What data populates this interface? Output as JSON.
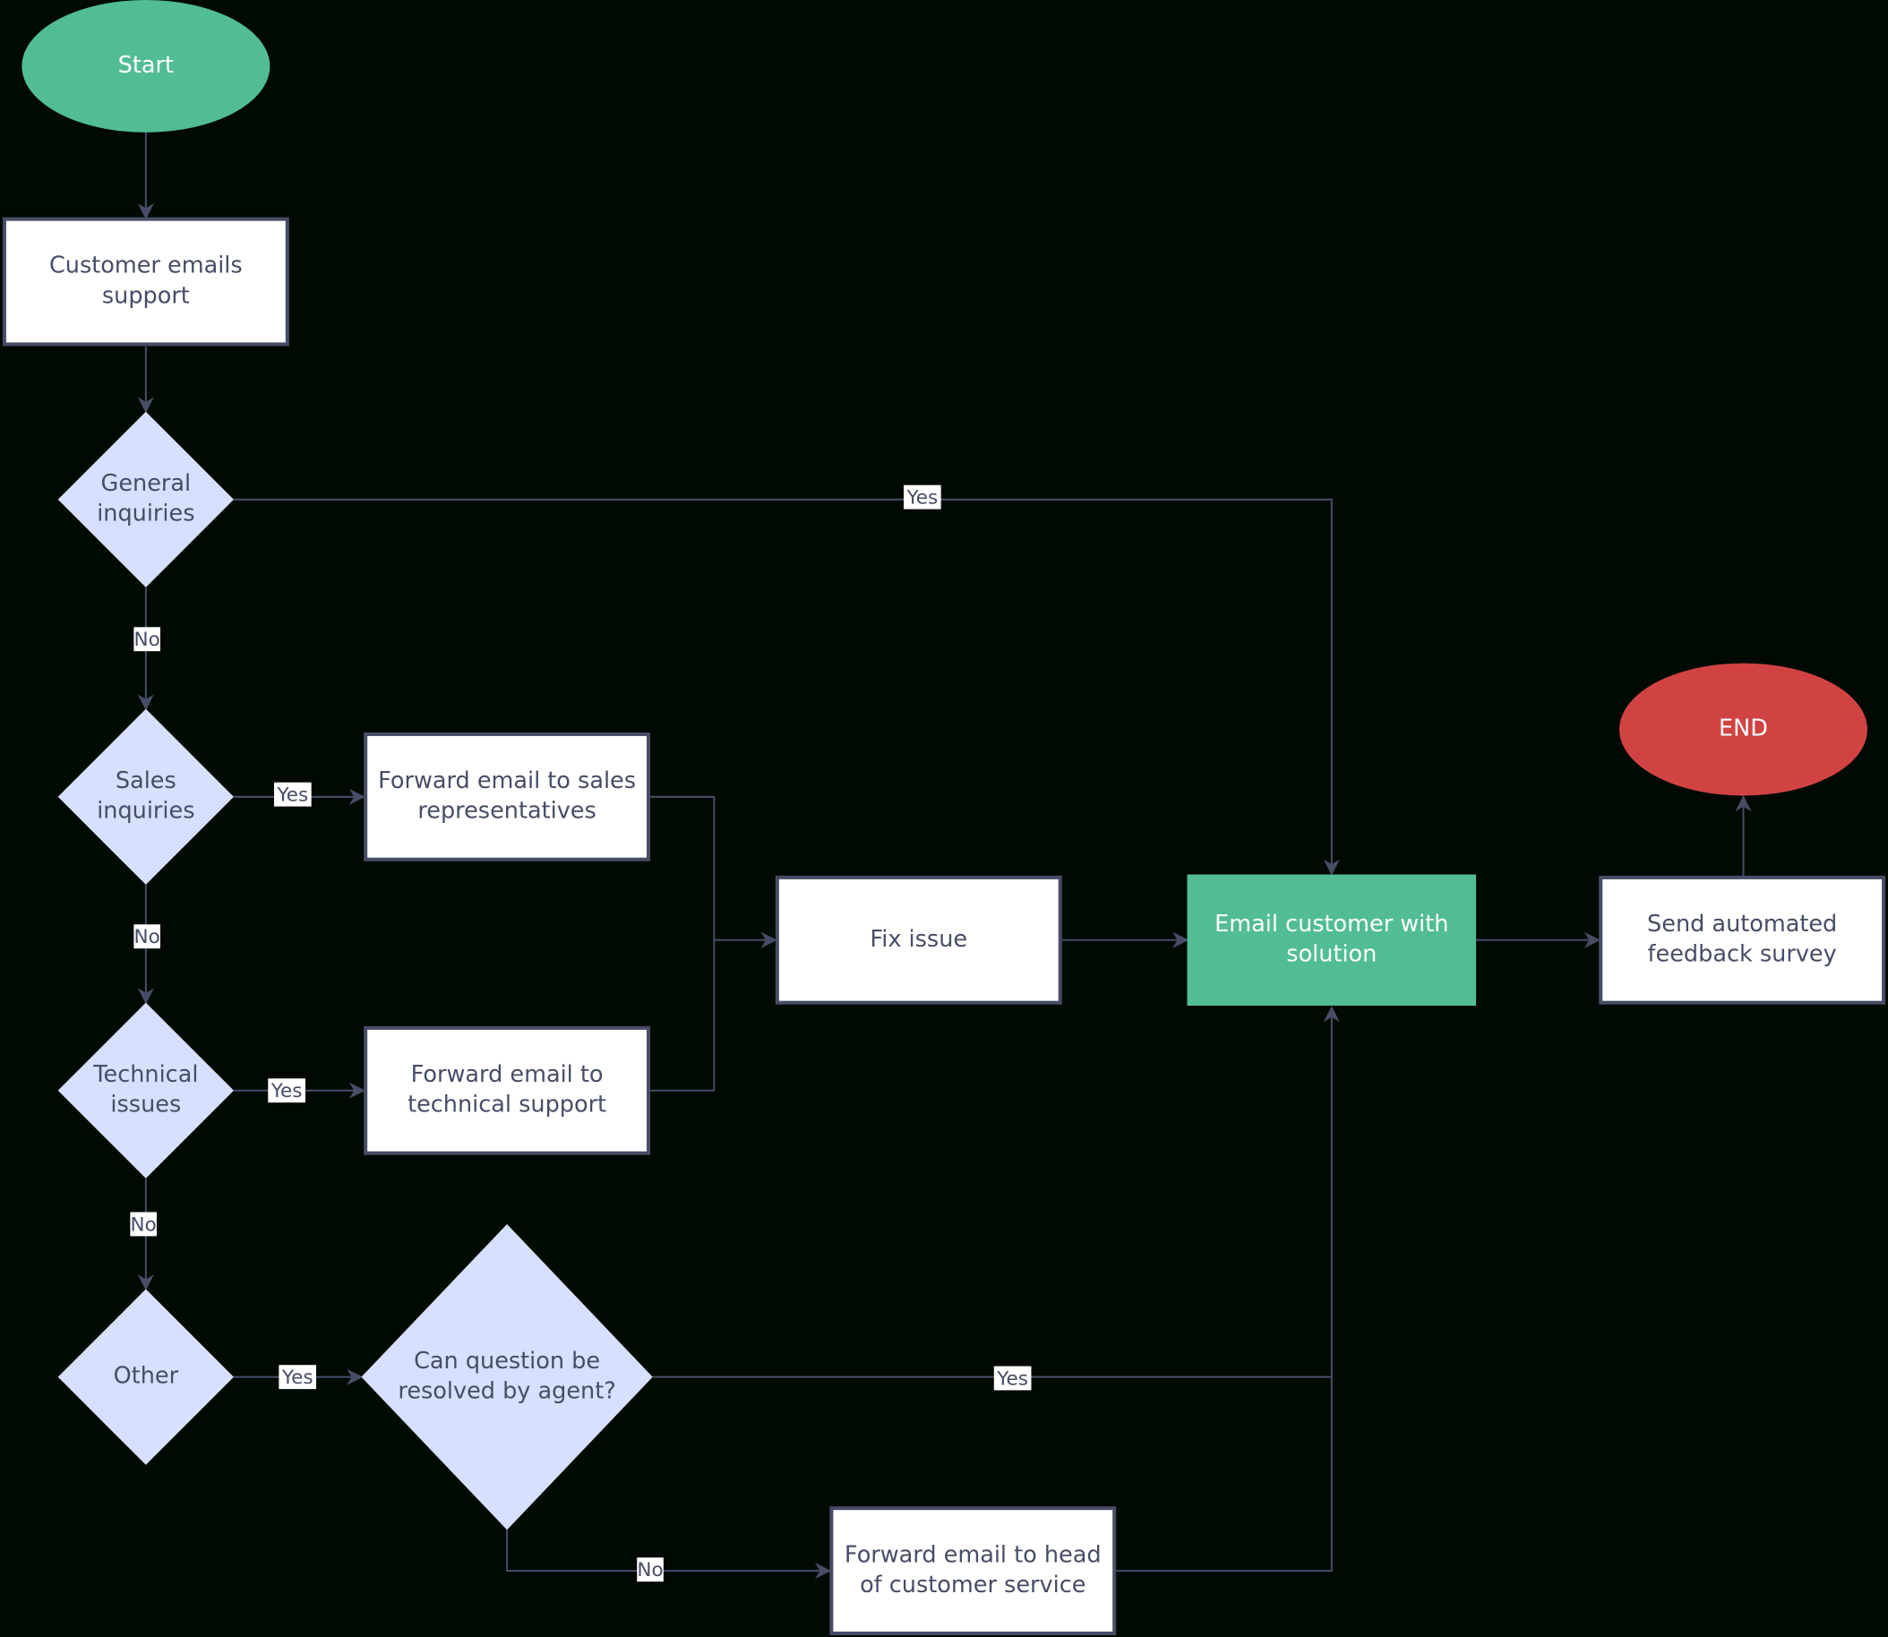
{
  "colors": {
    "background": "#000a02",
    "start_terminal": "#52bd94",
    "end_terminal": "#d14343",
    "decision_fill": "#d6e0ff",
    "process_fill": "#ffffff",
    "highlight_process": "#52bd94",
    "stroke": "#474d66",
    "text": "#474d66"
  },
  "nodes": [
    {
      "id": "start",
      "shape": "terminal",
      "lines": [
        "Start"
      ]
    },
    {
      "id": "customer_emails",
      "shape": "process",
      "lines": [
        "Customer emails",
        "support"
      ]
    },
    {
      "id": "general",
      "shape": "decision",
      "lines": [
        "General",
        "inquiries"
      ]
    },
    {
      "id": "sales",
      "shape": "decision",
      "lines": [
        "Sales",
        "inquiries"
      ]
    },
    {
      "id": "technical",
      "shape": "decision",
      "lines": [
        "Technical",
        "issues"
      ]
    },
    {
      "id": "other",
      "shape": "decision",
      "lines": [
        "Other"
      ]
    },
    {
      "id": "fwd_sales",
      "shape": "process",
      "lines": [
        "Forward email to sales",
        "representatives"
      ]
    },
    {
      "id": "fwd_tech",
      "shape": "process",
      "lines": [
        "Forward email to",
        "technical support"
      ]
    },
    {
      "id": "can_resolve",
      "shape": "decision",
      "lines": [
        "Can question be",
        "resolved by agent?"
      ]
    },
    {
      "id": "fix",
      "shape": "process",
      "lines": [
        "Fix issue"
      ]
    },
    {
      "id": "email_customer",
      "shape": "process-highlight",
      "lines": [
        "Email customer with",
        "solution"
      ]
    },
    {
      "id": "survey",
      "shape": "process",
      "lines": [
        "Send automated",
        "feedback survey"
      ]
    },
    {
      "id": "end",
      "shape": "terminal-end",
      "lines": [
        "END"
      ]
    },
    {
      "id": "fwd_head",
      "shape": "process",
      "lines": [
        "Forward email to head",
        "of customer service"
      ]
    }
  ],
  "edges": [
    {
      "from": "start",
      "to": "customer_emails",
      "label": ""
    },
    {
      "from": "customer_emails",
      "to": "general",
      "label": ""
    },
    {
      "from": "general",
      "to": "email_customer",
      "label": "Yes"
    },
    {
      "from": "general",
      "to": "sales",
      "label": "No"
    },
    {
      "from": "sales",
      "to": "fwd_sales",
      "label": "Yes"
    },
    {
      "from": "sales",
      "to": "technical",
      "label": "No"
    },
    {
      "from": "technical",
      "to": "fwd_tech",
      "label": "Yes"
    },
    {
      "from": "technical",
      "to": "other",
      "label": "No"
    },
    {
      "from": "other",
      "to": "can_resolve",
      "label": "Yes"
    },
    {
      "from": "can_resolve",
      "to": "email_customer",
      "label": "Yes"
    },
    {
      "from": "can_resolve",
      "to": "fwd_head",
      "label": "No"
    },
    {
      "from": "fwd_head",
      "to": "email_customer",
      "label": ""
    },
    {
      "from": "fwd_sales",
      "to": "fix",
      "label": ""
    },
    {
      "from": "fwd_tech",
      "to": "fix",
      "label": ""
    },
    {
      "from": "fix",
      "to": "email_customer",
      "label": ""
    },
    {
      "from": "email_customer",
      "to": "survey",
      "label": ""
    },
    {
      "from": "survey",
      "to": "end",
      "label": ""
    }
  ]
}
